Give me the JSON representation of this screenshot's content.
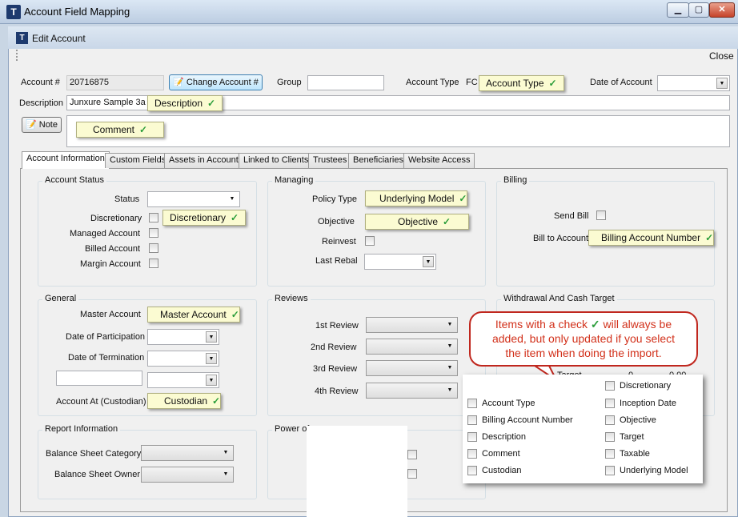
{
  "outer_window": {
    "title": "Account Field Mapping",
    "buttons": [
      "▁",
      "▢",
      "✕"
    ]
  },
  "inner_window": {
    "title": "Edit Account",
    "close_label": "Close"
  },
  "header": {
    "account_no_label": "Account #",
    "account_no_value": "20716875",
    "change_account_label": "Change Account #",
    "group_label": "Group",
    "account_type_label": "Account Type",
    "account_type_value": "FC",
    "date_of_account_label": "Date of Account",
    "description_label": "Description",
    "description_value": "Junxure Sample 3a",
    "note_label": "Note"
  },
  "callouts": {
    "account_type": "Account Type",
    "description": "Description",
    "comment": "Comment",
    "discretionary": "Discretionary",
    "underlying_model": "Underlying Model",
    "objective": "Objective",
    "billing_account_number": "Billing Account Number",
    "master_account": "Master Account",
    "custodian": "Custodian",
    "check": "✓"
  },
  "tabs": [
    "Account Information",
    "Custom Fields",
    "Assets in Account",
    "Linked to Clients",
    "Trustees",
    "Beneficiaries",
    "Website Access"
  ],
  "account_status": {
    "title": "Account Status",
    "status_label": "Status",
    "discretionary_label": "Discretionary",
    "managed_label": "Managed Account",
    "billed_label": "Billed Account",
    "margin_label": "Margin Account"
  },
  "managing": {
    "title": "Managing",
    "policy_type_label": "Policy Type",
    "objective_label": "Objective",
    "reinvest_label": "Reinvest",
    "last_rebal_label": "Last Rebal"
  },
  "billing": {
    "title": "Billing",
    "send_bill_label": "Send Bill",
    "bill_to_label": "Bill to Account"
  },
  "general": {
    "title": "General",
    "master_label": "Master Account",
    "participation_label": "Date of Participation",
    "termination_label": "Date of Termination",
    "account_at_label": "Account At (Custodian)"
  },
  "reviews": {
    "title": "Reviews",
    "items": [
      "1st Review",
      "2nd Review",
      "3rd Review",
      "4th Review"
    ]
  },
  "withdrawal": {
    "title": "Withdrawal And Cash Target",
    "partial_label": "h Target",
    "partial_value1": "0",
    "partial_value2": "0.00"
  },
  "report_info": {
    "title": "Report Information",
    "bs_category_label": "Balance Sheet Category",
    "bs_owner_label": "Balance Sheet Owner"
  },
  "power_of": {
    "title": "Power of"
  },
  "annotation": {
    "bubble_line1a": "Items with a check",
    "bubble_line1b": "will always be",
    "bubble_line2": "added, but only updated if you select",
    "bubble_line3": "the item when doing the import.",
    "legend_left": [
      "Account Type",
      "Billing Account Number",
      "Description",
      "Comment",
      "Custodian"
    ],
    "legend_right": [
      "Discretionary",
      "Inception Date",
      "Objective",
      "Target",
      "Taxable",
      "Underlying Model"
    ]
  },
  "colors": {
    "callout_bg": "#fbfbd2",
    "check_green": "#2a9d3a",
    "bubble_red": "#c0271e"
  }
}
